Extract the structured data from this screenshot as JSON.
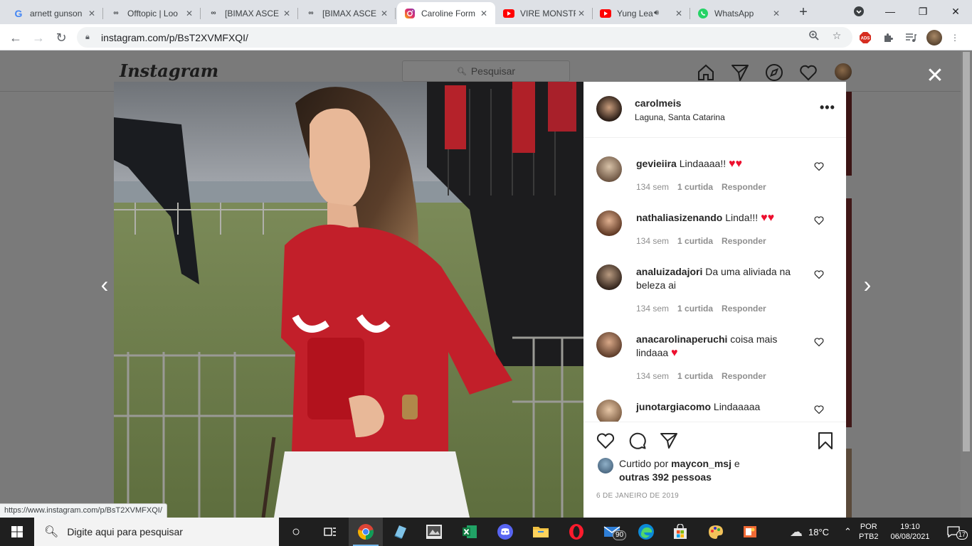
{
  "browser": {
    "tabs": [
      {
        "title": "arnett gunson",
        "icon": "google-icon",
        "color": "#4285f4"
      },
      {
        "title": "Offtopic | Loo",
        "icon": "forum-icon",
        "color": "#3c4043"
      },
      {
        "title": "[BIMAX ASCE",
        "icon": "forum-icon",
        "color": "#3c4043"
      },
      {
        "title": "[BIMAX ASCE",
        "icon": "forum-icon",
        "color": "#3c4043"
      },
      {
        "title": "Caroline Form",
        "icon": "instagram-icon",
        "color": "#e1306c",
        "active": true
      },
      {
        "title": "VIRE MONSTR",
        "icon": "youtube-icon",
        "color": "#ff0000"
      },
      {
        "title": "Yung Lea",
        "icon": "youtube-icon",
        "color": "#ff0000",
        "audio": true
      },
      {
        "title": "WhatsApp",
        "icon": "whatsapp-icon",
        "color": "#25d366"
      }
    ],
    "url": "instagram.com/p/BsT2XVMFXQI/",
    "status_url": "https://www.instagram.com/p/BsT2XVMFXQI/"
  },
  "instagram": {
    "logo": "Instagram",
    "search_placeholder": "Pesquisar",
    "post": {
      "username": "carolmeis",
      "location": "Laguna, Santa Catarina",
      "comments": [
        {
          "user": "gevieiira",
          "text": "Lindaaaa!!",
          "hearts": "♥♥",
          "time": "134 sem",
          "likes": "1 curtida",
          "reply": "Responder"
        },
        {
          "user": "nathaliasizenando",
          "text": "Linda!!!",
          "hearts": "♥♥",
          "time": "134 sem",
          "likes": "1 curtida",
          "reply": "Responder"
        },
        {
          "user": "analuizadajori",
          "text": "Da uma aliviada na beleza ai",
          "hearts": "",
          "time": "134 sem",
          "likes": "1 curtida",
          "reply": "Responder"
        },
        {
          "user": "anacarolinaperuchi",
          "text": "coisa mais lindaaa",
          "hearts": "♥",
          "time": "134 sem",
          "likes": "1 curtida",
          "reply": "Responder"
        },
        {
          "user": "junotargiacomo",
          "text": "Lindaaaaa",
          "hearts": "",
          "time": "",
          "likes": "",
          "reply": ""
        }
      ],
      "liked_by_prefix": "Curtido por",
      "liked_by_user": "maycon_msj",
      "liked_by_and": "e",
      "liked_by_others": "outras 392 pessoas",
      "date": "6 DE JANEIRO DE 2019"
    }
  },
  "taskbar": {
    "search_placeholder": "Digite aqui para pesquisar",
    "mail_badge": "90",
    "weather": "18°C",
    "lang_line1": "POR",
    "lang_line2": "PTB2",
    "time": "19:10",
    "date": "06/08/2021",
    "notifications": "17"
  }
}
